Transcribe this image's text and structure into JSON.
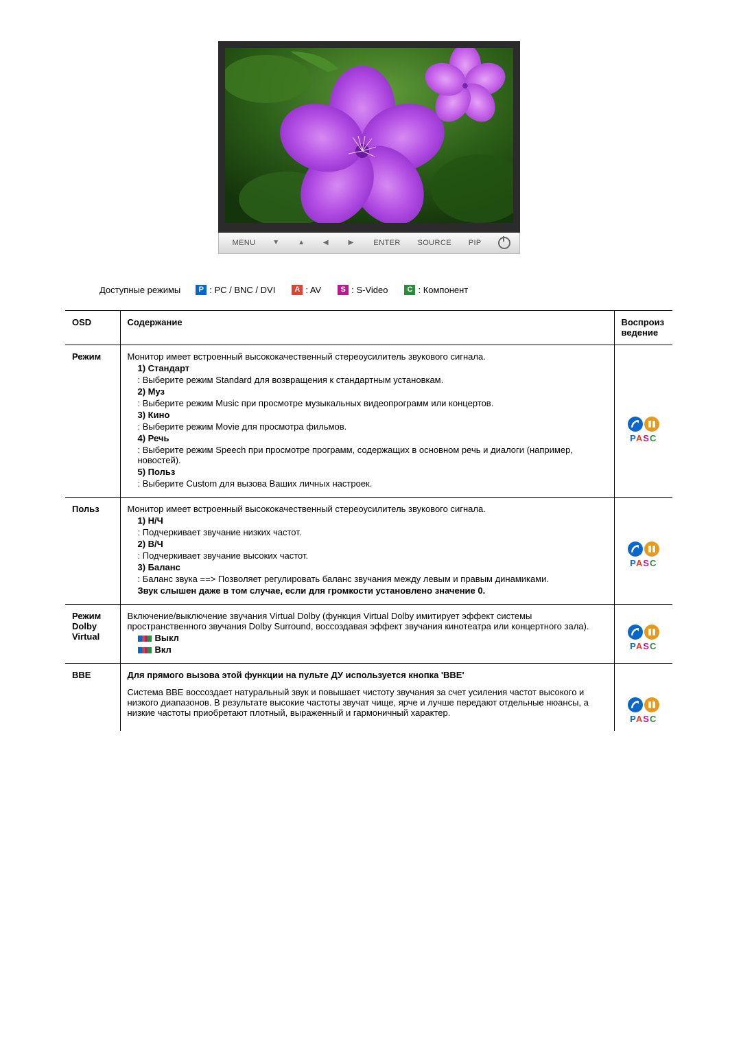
{
  "monitor": {
    "controls": {
      "menu": "MENU",
      "enter": "ENTER",
      "source": "SOURCE",
      "pip": "PIP"
    }
  },
  "legend": {
    "title": "Доступные режимы",
    "items": [
      {
        "badge": "P",
        "text": ": PC / BNC / DVI",
        "cls": "bP"
      },
      {
        "badge": "A",
        "text": ": AV",
        "cls": "bA"
      },
      {
        "badge": "S",
        "text": ": S-Video",
        "cls": "bS"
      },
      {
        "badge": "C",
        "text": ": Компонент",
        "cls": "bC"
      }
    ]
  },
  "table": {
    "head": {
      "osd": "OSD",
      "content": "Содержание",
      "repro": "Воспроиз\nведение"
    },
    "rows": [
      {
        "osd": "Режим",
        "intro": "Монитор имеет встроенный высококачественный стереоусилитель звукового сигнала.",
        "subs": [
          {
            "t": "1) Стандарт",
            "d": ": Выберите режим Standard для возвращения к стандартным установкам."
          },
          {
            "t": "2) Муз",
            "d": ": Выберите режим Music при просмотре музыкальных видеопрограмм или концертов."
          },
          {
            "t": "3) Кино",
            "d": ": Выберите режим Movie для просмотра фильмов."
          },
          {
            "t": "4) Речь",
            "d": ": Выберите режим Speech при просмотре программ, содержащих в основном речь и диалоги (например, новостей)."
          },
          {
            "t": "5) Польз",
            "d": ": Выберите Custom для вызова Ваших личных настроек."
          }
        ]
      },
      {
        "osd": "Польз",
        "intro": "Монитор имеет встроенный высококачественный стереоусилитель звукового сигнала.",
        "subs": [
          {
            "t": "1) Н/Ч",
            "d": ": Подчеркивает звучание низких частот."
          },
          {
            "t": "2) В/Ч",
            "d": ": Подчеркивает звучание высоких частот."
          },
          {
            "t": "3) Баланс",
            "d": ": Баланс звука ==> Позволяет регулировать баланс звучания между левым и правым динамиками."
          }
        ],
        "tail_bold": "Звук слышен даже в том случае, если для громкости установлено значение 0."
      },
      {
        "osd": "Режим Dolby Virtual",
        "intro": "Включение/выключение звучания Virtual Dolby (функция Virtual Dolby имитирует эффект системы пространственного звучания Dolby Surround, воссоздавая эффект звучания кинотеатра или концертного зала).",
        "flags": [
          "Выкл",
          "Вкл"
        ]
      },
      {
        "osd": "BBE",
        "bold_intro": "Для прямого вызова этой функции на пульте ДУ используется кнопка 'BBE'",
        "body": "Система BBE воссоздает натуральный звук и повышает чистоту звучания за счет усиления частот высокого и низкого диапазонов. В результате высокие частоты звучат чище, ярче и лучше передают отдельные нюансы, а низкие частоты приобретают плотный, выраженный и гармоничный характер.",
        "bold_inline": "BBE"
      }
    ]
  }
}
